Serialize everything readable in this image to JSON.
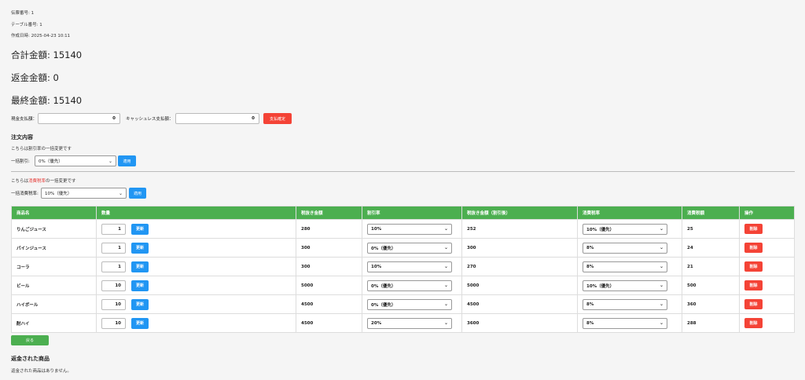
{
  "meta": {
    "slip_number": "伝票番号: 1",
    "table_number": "テーブル番号: 1",
    "created_at": "作成日時: 2025-04-23 10:11"
  },
  "amounts": {
    "total": "合計金額: 15140",
    "refund": "返金金額: 0",
    "final": "最終金額: 15140"
  },
  "payment": {
    "cash_label": "現金支払額：",
    "cash_value": "0",
    "cashless_label": "キャッシュレス支払額：",
    "cashless_value": "0",
    "confirm_button": "支払確定"
  },
  "order": {
    "title": "注文内容",
    "discount_note": "こちらは割引率の一括変更です",
    "bulk_discount_label": "一括割引:",
    "bulk_discount_value": "0%（優先）",
    "apply_button": "適用",
    "tax_note_prefix": "こちらは",
    "tax_note_highlight": "消費税率",
    "tax_note_suffix": "の一括変更です",
    "bulk_tax_label": "一括消費税率:",
    "bulk_tax_value": "10%（優先）"
  },
  "table": {
    "headers": [
      "商品名",
      "数量",
      "税抜き金額",
      "割引率",
      "税抜き金額（割引後）",
      "消費税率",
      "消費税額",
      "操作"
    ],
    "update_button": "更新",
    "delete_button": "削除",
    "rows": [
      {
        "name": "りんごジュース",
        "qty": "1",
        "price": "280",
        "discount": "10%",
        "discounted": "252",
        "tax_rate": "10%（優先）",
        "tax": "25"
      },
      {
        "name": "パインジュース",
        "qty": "1",
        "price": "300",
        "discount": "0%（優先）",
        "discounted": "300",
        "tax_rate": "8%",
        "tax": "24"
      },
      {
        "name": "コーラ",
        "qty": "1",
        "price": "300",
        "discount": "10%",
        "discounted": "270",
        "tax_rate": "8%",
        "tax": "21"
      },
      {
        "name": "ビール",
        "qty": "10",
        "price": "5000",
        "discount": "0%（優先）",
        "discounted": "5000",
        "tax_rate": "10%（優先）",
        "tax": "500"
      },
      {
        "name": "ハイボール",
        "qty": "10",
        "price": "4500",
        "discount": "0%（優先）",
        "discounted": "4500",
        "tax_rate": "8%",
        "tax": "360"
      },
      {
        "name": "酎ハイ",
        "qty": "10",
        "price": "4500",
        "discount": "20%",
        "discounted": "3600",
        "tax_rate": "8%",
        "tax": "288"
      }
    ]
  },
  "back_button": "戻る",
  "refunds": {
    "title": "返金された商品",
    "empty_text": "返金された商品はありません。"
  }
}
